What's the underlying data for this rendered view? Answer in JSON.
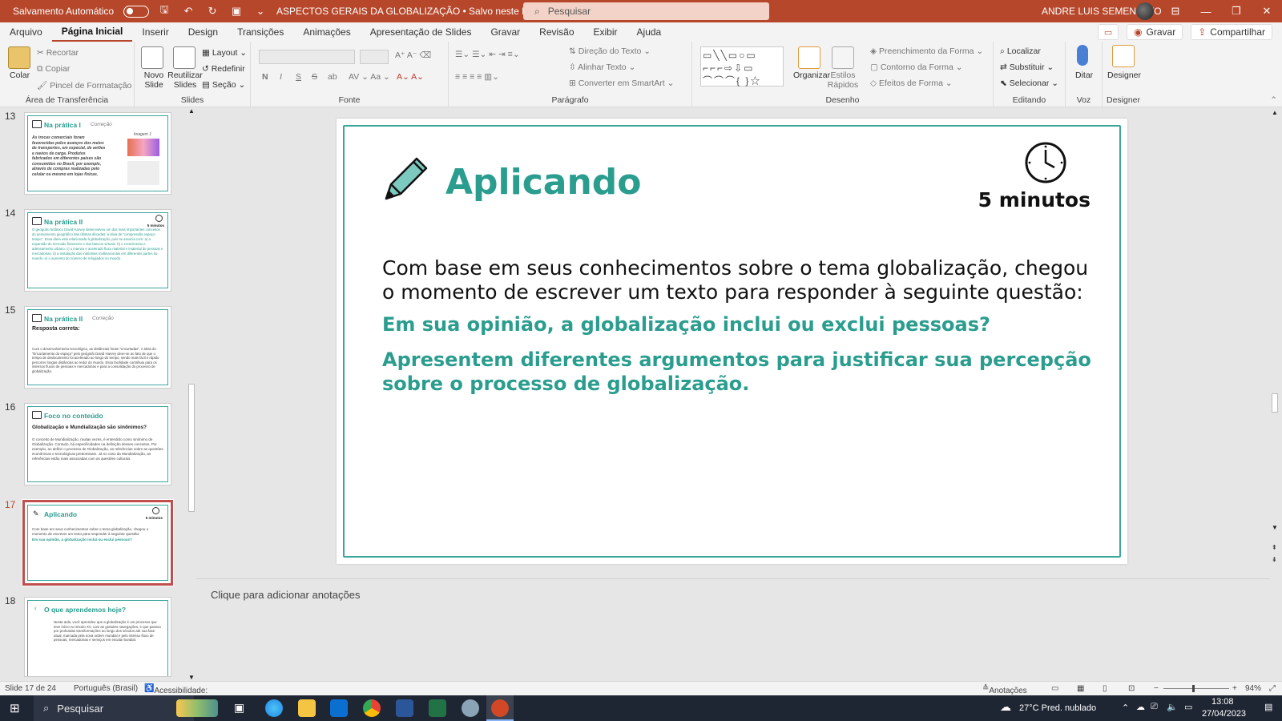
{
  "titlebar": {
    "autosave": "Salvamento Automático",
    "doc_title": "ASPECTOS GERAIS DA GLOBALIZAÇÃO • Salvo neste PC",
    "search_placeholder": "Pesquisar",
    "user": "ANDRE LUIS SEMENSATO",
    "minimize": "—",
    "restore": "❐",
    "close": "✕"
  },
  "tabs": [
    "Arquivo",
    "Página Inicial",
    "Inserir",
    "Design",
    "Transições",
    "Animações",
    "Apresentação de Slides",
    "Gravar",
    "Revisão",
    "Exibir",
    "Ajuda"
  ],
  "tabs_right": {
    "record": "Gravar",
    "share": "Compartilhar"
  },
  "ribbon": {
    "clipboard": {
      "paste": "Colar",
      "cut": "Recortar",
      "copy": "Copiar",
      "format_painter": "Pincel de Formatação",
      "label": "Área de Transferência"
    },
    "slides": {
      "new_slide": "Novo Slide",
      "reuse": "Reutilizar Slides",
      "layout": "Layout",
      "reset": "Redefinir",
      "section": "Seção",
      "label": "Slides"
    },
    "font": {
      "bold": "N",
      "italic": "I",
      "underline": "S",
      "strike": "S",
      "shadow": "ab",
      "label": "Fonte"
    },
    "paragraph": {
      "text_direction": "Direção do Texto",
      "align_text": "Alinhar Texto",
      "smartart": "Converter em SmartArt",
      "label": "Parágrafo"
    },
    "drawing": {
      "arrange": "Organizar",
      "quick_styles": "Estilos Rápidos",
      "fill": "Preenchimento da Forma",
      "outline": "Contorno da Forma",
      "effects": "Efeitos de Forma",
      "label": "Desenho"
    },
    "editing": {
      "find": "Localizar",
      "replace": "Substituir",
      "select": "Selecionar",
      "label": "Editando"
    },
    "voice": {
      "dictate": "Ditar",
      "label": "Voz"
    },
    "designer": {
      "designer": "Designer",
      "label": "Designer"
    }
  },
  "thumbnails": [
    {
      "num": "13",
      "title": "Na prática I",
      "subtitle": "Correção",
      "body": "As trocas comerciais foram favorecidas pelos avanços dos meios de transportes, em especial, de aviões e navios de carga. Produtos fabricados em diferentes países são consumidos no Brasil, por exemplo, através de compras realizadas pelo celular ou mesmo em lojas físicas.",
      "highlight": ""
    },
    {
      "num": "14",
      "title": "Na prática II",
      "subtitle": "",
      "body": "O geógrafo britânico David Harvey desenvolveu um dos mais importantes conceitos do pensamento geográfico das últimas décadas: a ideia de “compressão espaço-tempo”. Essa ideia está relacionada à globalização, pois se associa com: a) a expansão do mercado financeiro e dos bancos virtuais. b) o crescimento e adensamento urbano. c) o intenso e acelerado fluxo material e imaterial de pessoas e mercadorias. d) a instalação das indústrias multinacionais em diferentes partes do mundo. e) o aumento do número de refugiados no mundo.",
      "highlight": ""
    },
    {
      "num": "15",
      "title": "Na prática II",
      "subtitle": "Correção",
      "body": "Com o desenvolvimento tecnológico, as distâncias foram “encurtadas”. A ideia do “Encurtamento do espaço” pelo geógrafo David Harvey deve-se ao fato de que o tempo de deslocamento foi acelerado ao longo do tempo, sendo mais fácil e rápido percorrer longas distâncias ao redor do mundo. Essa facilidade contribuiu para os intensos fluxos de pessoas e mercadorias e para a consolidação do processo de globalização.",
      "highlight": "Resposta correta:"
    },
    {
      "num": "16",
      "title": "Foco no conteúdo",
      "subtitle": "",
      "body": "O conceito de Mundialização, muitas vezes, é entendido como sinônimo de Globalização. Contudo, há especificidades na definição desses conceitos. Por exemplo, ao definir o processo de Globalização, as referências sobre as questões econômicas e tecnológicas predominam. Já no caso da Mundialização, as referências estão mais associadas com as questões culturais.",
      "highlight": "Globalização e Mundialização são sinônimos?"
    },
    {
      "num": "17",
      "title": "Aplicando",
      "subtitle": "",
      "body": "Com base em seus conhecimentos sobre o tema globalização, chegou o momento de escrever um texto para responder à seguinte questão:",
      "highlight": "Em sua opinião, a globalização inclui ou exclui pessoas?"
    },
    {
      "num": "18",
      "title": "O que aprendemos hoje?",
      "subtitle": "",
      "body": "Nesta aula, você aprendeu que a globalização é um processo que teve início no século XV, com as grandes navegações, e que passou por profundas transformações ao longo dos séculos até sua fase atual, marcada pela nova ordem mundial e pelo intenso fluxo de pessoas, mercadorias e serviços em escala mundial.",
      "highlight": ""
    }
  ],
  "thumb_extras": {
    "minutes": "5 minutos",
    "image_label": "Imagem 1"
  },
  "slide": {
    "title": "Aplicando",
    "minutes": "5 minutos",
    "body": "Com base em seus conhecimentos sobre o tema globalização, chegou o momento de escrever um texto para responder à seguinte questão:",
    "question1": "Em sua opinião, a globalização inclui ou exclui pessoas?",
    "question2": "Apresentem diferentes argumentos para justificar sua percepção sobre o processo de globalização."
  },
  "notes_placeholder": "Clique para adicionar anotações",
  "status": {
    "slide": "Slide 17 de 24",
    "language": "Português (Brasil)",
    "accessibility": "Acessibilidade: investigar",
    "notes": "Anotações",
    "zoom": "94%"
  },
  "taskbar": {
    "search": "Pesquisar",
    "weather": "27°C  Pred. nublado",
    "time": "13:08",
    "date": "27/04/2023"
  },
  "colors": {
    "accent": "#b7472a",
    "teal": "#2a9d8f"
  }
}
